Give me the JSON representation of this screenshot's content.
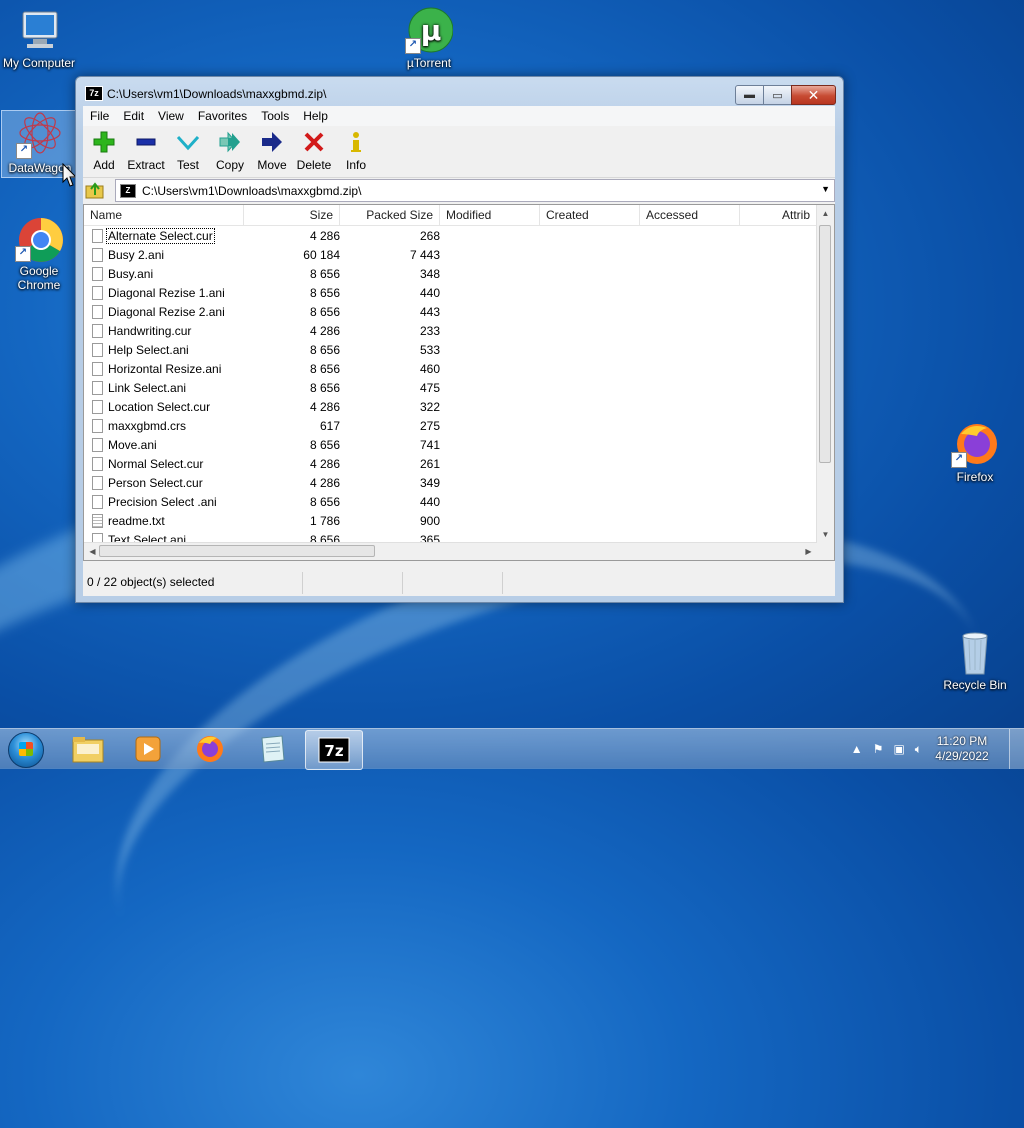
{
  "desktop": {
    "icons": [
      {
        "label": "My Computer"
      },
      {
        "label": "µTorrent"
      },
      {
        "label": "DataWagon"
      },
      {
        "label": "Google Chrome"
      },
      {
        "label": "Firefox"
      },
      {
        "label": "Recycle Bin"
      }
    ]
  },
  "window": {
    "title": "C:\\Users\\vm1\\Downloads\\maxxgbmd.zip\\",
    "app_icon_text": "7z",
    "menu": [
      "File",
      "Edit",
      "View",
      "Favorites",
      "Tools",
      "Help"
    ],
    "toolbar": [
      {
        "label": "Add",
        "icon": "plus-icon",
        "color": "#2db51c"
      },
      {
        "label": "Extract",
        "icon": "minus-icon",
        "color": "#1a2fa8"
      },
      {
        "label": "Test",
        "icon": "check-icon",
        "color": "#1fb0c8"
      },
      {
        "label": "Copy",
        "icon": "double-arrow-icon",
        "color": "#22a08f"
      },
      {
        "label": "Move",
        "icon": "arrow-right-icon",
        "color": "#1a2a8a"
      },
      {
        "label": "Delete",
        "icon": "x-icon",
        "color": "#d21a1a"
      },
      {
        "label": "Info",
        "icon": "info-icon",
        "color": "#d8b800"
      }
    ],
    "address": "C:\\Users\\vm1\\Downloads\\maxxgbmd.zip\\",
    "columns": [
      "Name",
      "Size",
      "Packed Size",
      "Modified",
      "Created",
      "Accessed",
      "Attrib"
    ],
    "files": [
      {
        "name": "Alternate Select.cur",
        "size": "4 286",
        "packed": "268"
      },
      {
        "name": "Busy 2.ani",
        "size": "60 184",
        "packed": "7 443"
      },
      {
        "name": "Busy.ani",
        "size": "8 656",
        "packed": "348"
      },
      {
        "name": "Diagonal Rezise 1.ani",
        "size": "8 656",
        "packed": "440"
      },
      {
        "name": "Diagonal Rezise 2.ani",
        "size": "8 656",
        "packed": "443"
      },
      {
        "name": "Handwriting.cur",
        "size": "4 286",
        "packed": "233"
      },
      {
        "name": "Help Select.ani",
        "size": "8 656",
        "packed": "533"
      },
      {
        "name": "Horizontal Resize.ani",
        "size": "8 656",
        "packed": "460"
      },
      {
        "name": "Link Select.ani",
        "size": "8 656",
        "packed": "475"
      },
      {
        "name": "Location Select.cur",
        "size": "4 286",
        "packed": "322"
      },
      {
        "name": "maxxgbmd.crs",
        "size": "617",
        "packed": "275"
      },
      {
        "name": "Move.ani",
        "size": "8 656",
        "packed": "741"
      },
      {
        "name": "Normal Select.cur",
        "size": "4 286",
        "packed": "261"
      },
      {
        "name": "Person Select.cur",
        "size": "4 286",
        "packed": "349"
      },
      {
        "name": "Precision Select .ani",
        "size": "8 656",
        "packed": "440"
      },
      {
        "name": "readme.txt",
        "size": "1 786",
        "packed": "900"
      },
      {
        "name": "Text Select.ani",
        "size": "8 656",
        "packed": "365"
      }
    ],
    "status": "0 / 22 object(s) selected"
  },
  "taskbar": {
    "time": "11:20 PM",
    "date": "4/29/2022"
  }
}
